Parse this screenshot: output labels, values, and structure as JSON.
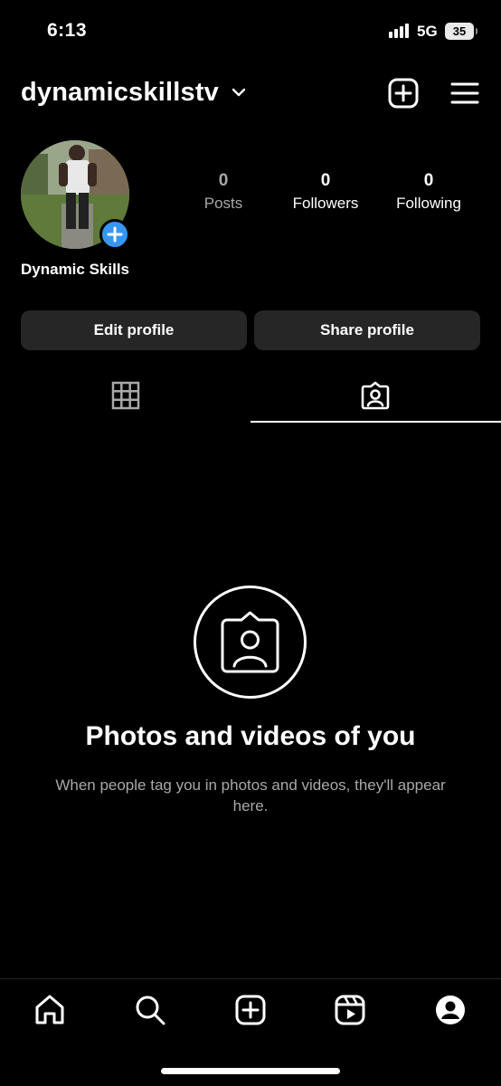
{
  "status_bar": {
    "time": "6:13",
    "network": "5G",
    "battery": "35",
    "signal_icon": "signal-bars-icon"
  },
  "header": {
    "username": "dynamicskillstv",
    "dropdown_icon": "chevron-down-icon",
    "new_post_icon": "plus-square-icon",
    "menu_icon": "hamburger-menu-icon"
  },
  "profile": {
    "display_name": "Dynamic Skills",
    "avatar_icon": "profile-photo",
    "add_story_icon": "plus-icon",
    "stats": {
      "posts": {
        "count": "0",
        "label": "Posts"
      },
      "followers": {
        "count": "0",
        "label": "Followers"
      },
      "following": {
        "count": "0",
        "label": "Following"
      }
    },
    "buttons": {
      "edit": "Edit profile",
      "share": "Share profile"
    }
  },
  "tabs": [
    {
      "icon": "grid-icon",
      "active": false
    },
    {
      "icon": "tagged-person-icon",
      "active": true
    }
  ],
  "empty_state": {
    "icon": "tagged-person-icon",
    "title": "Photos and videos of you",
    "subtitle": "When people tag you in photos and videos, they'll appear here."
  },
  "bottom_nav": [
    {
      "icon": "home-icon"
    },
    {
      "icon": "search-icon"
    },
    {
      "icon": "create-icon"
    },
    {
      "icon": "reels-icon"
    },
    {
      "icon": "profile-icon",
      "active": true
    }
  ],
  "colors": {
    "background": "#000000",
    "button_bg": "#262626",
    "secondary_text": "#a8a8a8",
    "accent": "#3797f0"
  }
}
